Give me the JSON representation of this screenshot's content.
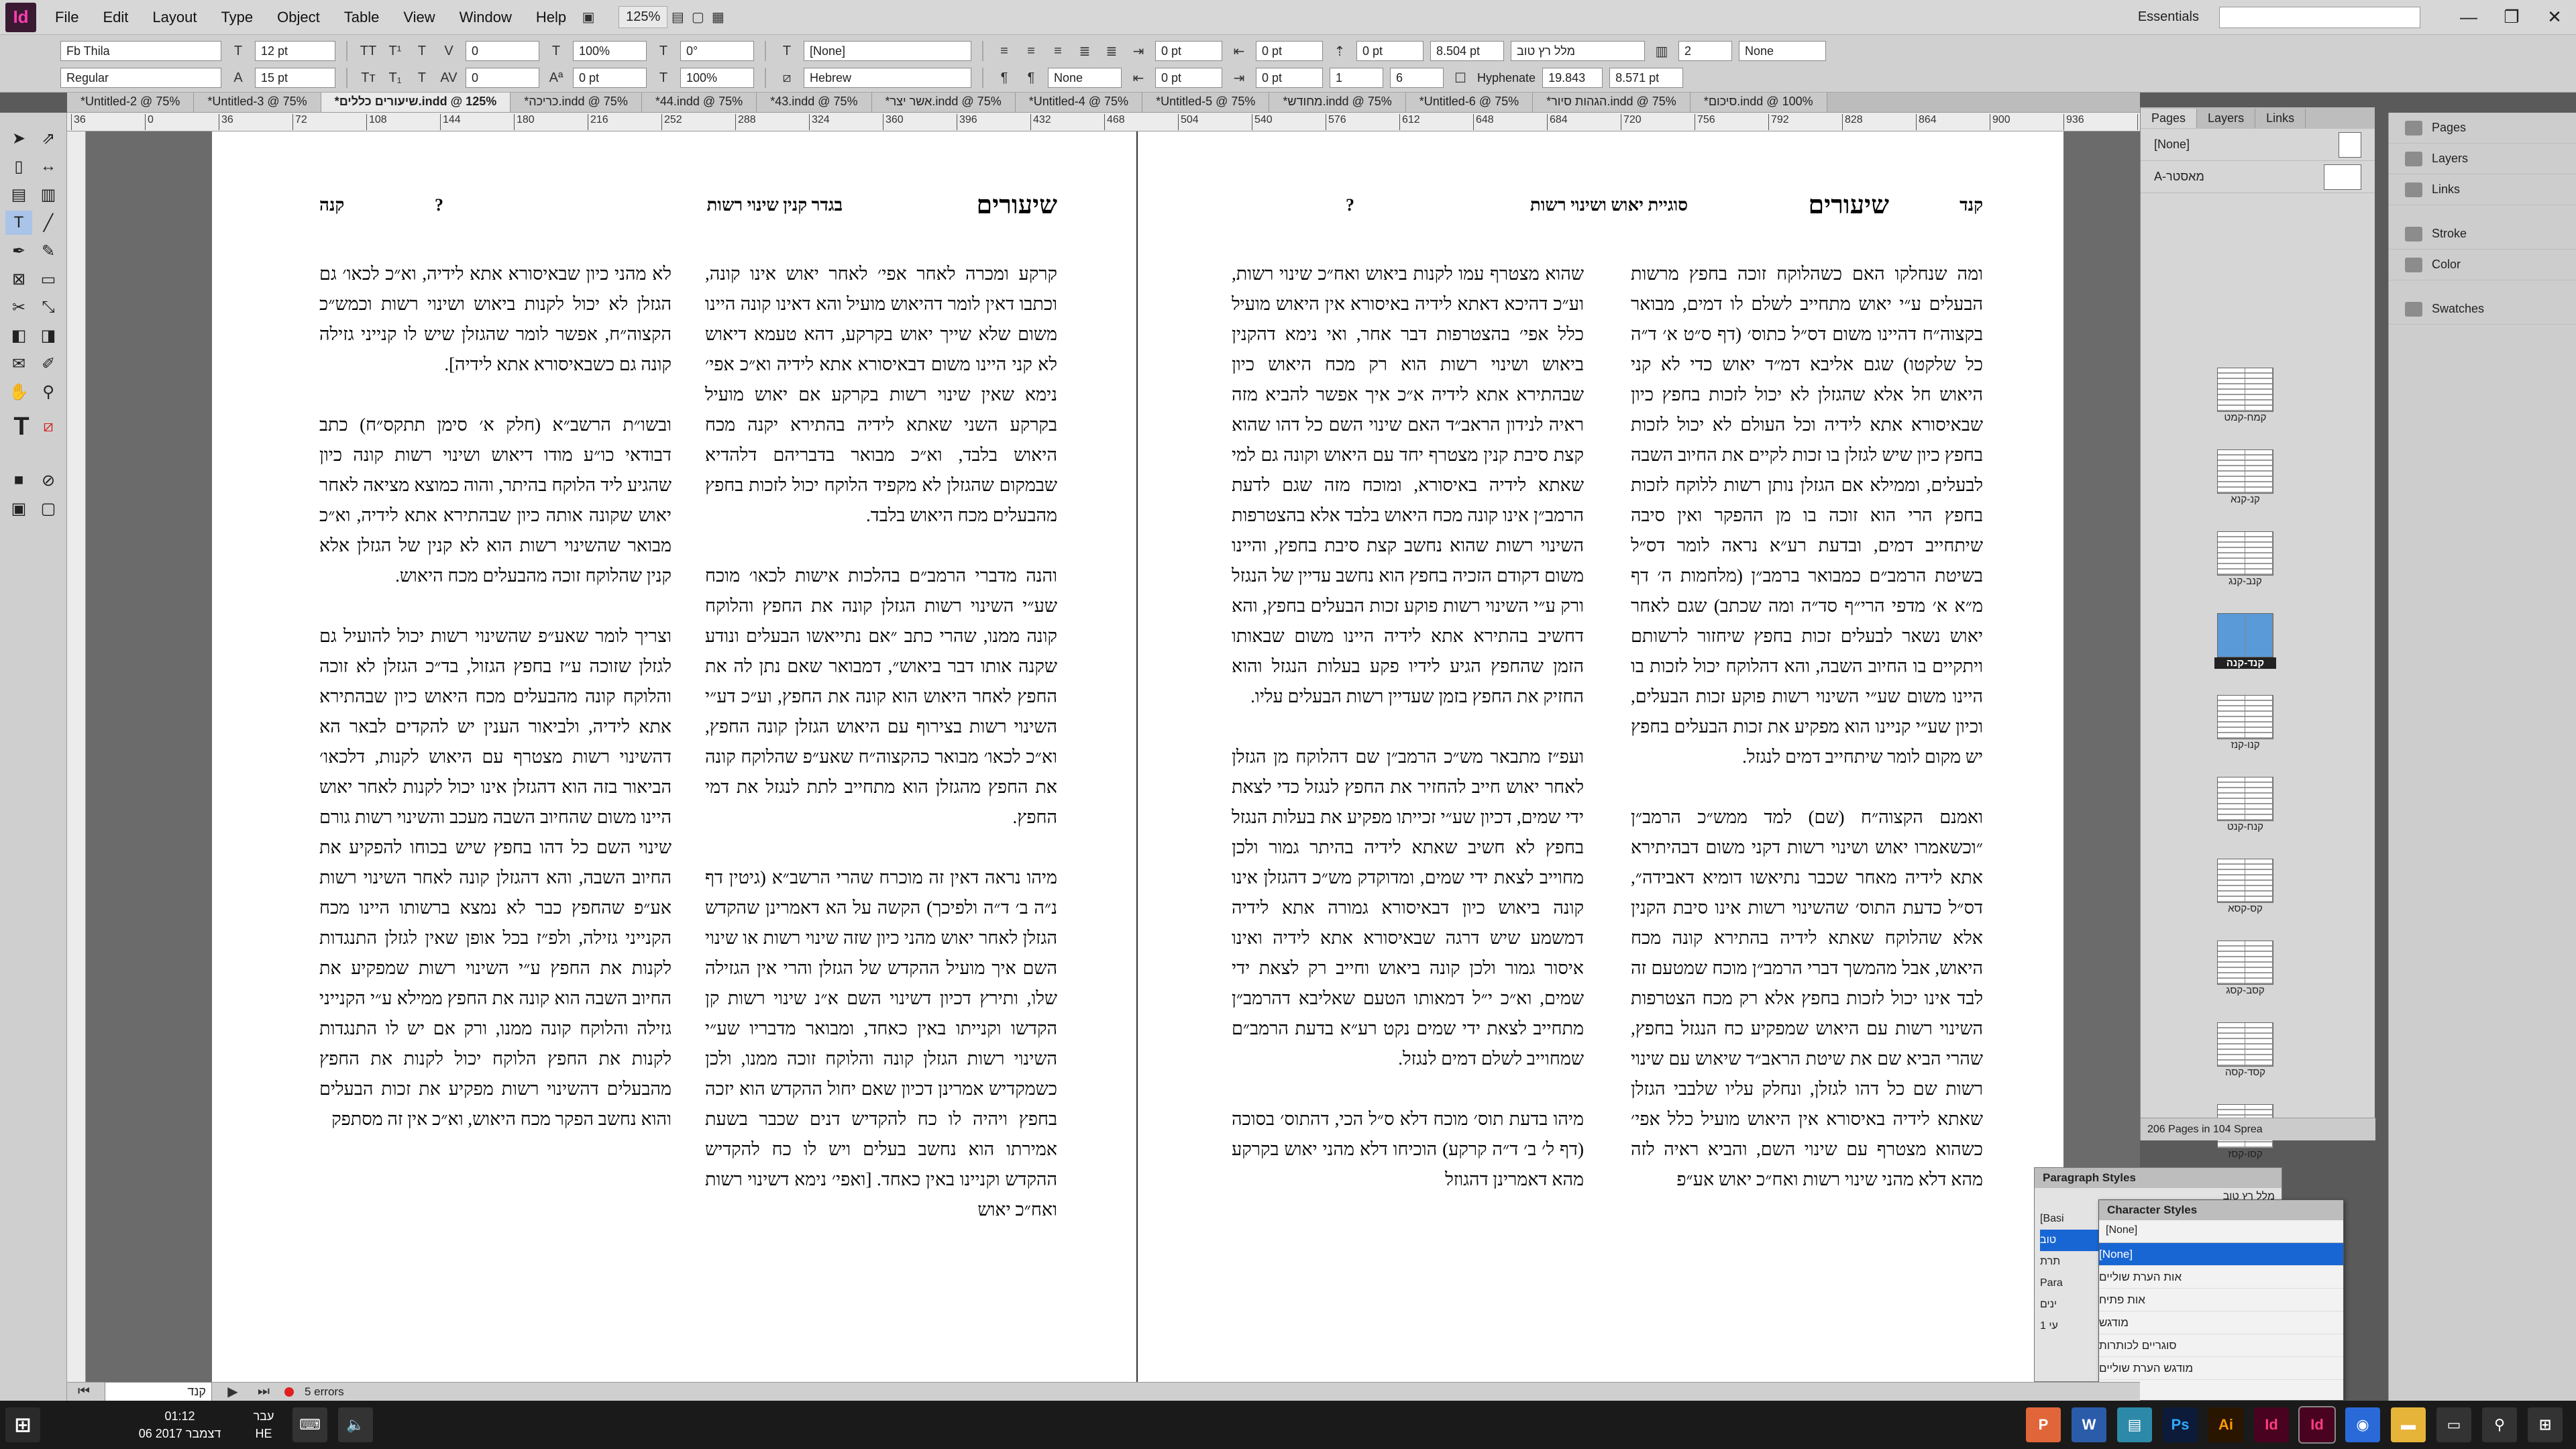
{
  "app": {
    "logo": "Id",
    "zoom": "125%",
    "workspace": "Essentials"
  },
  "menu": [
    "File",
    "Edit",
    "Layout",
    "Type",
    "Object",
    "Table",
    "View",
    "Window",
    "Help"
  ],
  "control": {
    "font": "Fb Thila",
    "style": "Regular",
    "size": "12 pt",
    "leading": "15 pt",
    "scale_v": "100%",
    "scale_h": "100%",
    "tracking": "0",
    "baseline": "0 pt",
    "skew": "0°",
    "char_style": "[None]",
    "language": "Hebrew",
    "indent1": "0 pt",
    "indent2": "0 pt",
    "indent3": "0 pt",
    "space1": "0 pt",
    "space_after": "8.504 pt",
    "para_style": "מלל רץ טוב",
    "cols": "2",
    "dropcap": "None",
    "hyphenate": "Hyphenate",
    "col_w": "19.843",
    "gutter": "8.571 pt",
    "val_none": "None",
    "n1": "1",
    "n6": "6"
  },
  "tabs": [
    "*Untitled-2 @ 75%",
    "*Untitled-3 @ 75%",
    "*שיעורים כללים.indd @ 125%",
    "*כריכה.indd @ 75%",
    "*44.indd @ 75%",
    "*43.indd @ 75%",
    "*אשר יצר.indd @ 75%",
    "*Untitled-4 @ 75%",
    "*Untitled-5 @ 75%",
    "*מחודש.indd @ 75%",
    "*Untitled-6 @ 75%",
    "*הגהות סיור.indd @ 75%",
    "*סיכום.indd @ 100%"
  ],
  "ruler_marks": [
    "36",
    "0",
    "36",
    "72",
    "108",
    "144",
    "180",
    "216",
    "252",
    "288",
    "324",
    "360",
    "396",
    "432",
    "468",
    "504",
    "540",
    "576",
    "612",
    "648",
    "684",
    "720",
    "756",
    "792",
    "828",
    "864",
    "900",
    "936",
    "972"
  ],
  "left_page": {
    "hdr_right": "שיעורים",
    "hdr_center": "בגדר קנין שינוי רשות",
    "hdr_q": "?",
    "hdr_left": "קנה",
    "col_right": "קרקע ומכרה לאחר אפי׳ לאחר יאוש אינו קונה, וכתבו דאין לומר דהיאוש מועיל והא דאינו קונה היינו משום שלא שייך יאוש בקרקע, דהא טעמא דיאוש לא קני היינו משום דבאיסורא אתא לידיה וא״כ אפי׳ נימא שאין שינוי רשות בקרקע אם יאוש מועיל בקרקע השני שאתא לידיה בהתירא יקנה מכח היאוש בלבד, וא״כ מבואר בדבריהם דלהדיא שבמקום שהגזלן לא מקפיד הלוקח יכול לזכות בחפץ מהבעלים מכח היאוש בלבד.\n\nוהנה מדברי הרמב״ם בהלכות אישות לכאו׳ מוכח שע״י השינוי רשות הגזלן קונה את החפץ והלוקח קונה ממנו, שהרי כתב ״אם נתייאשו הבעלים ונודע שקנה אותו דבר ביאוש״, דמבואר שאם נתן לה את החפץ לאחר היאוש הוא קונה את החפץ, וע״כ דע״י השינוי רשות בצירוף עם היאוש הגזלן קונה החפץ, וא״כ לכאו׳ מבואר כהקצוה״ח שאע״פ שהלוקח קונה את החפץ מהגזלן הוא מתחייב לתת לנגזל את דמי החפץ.\n\nמיהו נראה דאין זה מוכרח שהרי הרשב״א (גיטין דף נ״ה ב׳ ד״ה ולפיכך) הקשה על הא דאמרינן שהקדש הגזלן לאחר יאוש מהני כיון שזה שינוי רשות או שינוי השם איך מועיל ההקדש של הגזלן והרי אין הגזילה שלו, ותירץ דכיון דשינוי השם א״נ שינוי רשות קן הקדשו וקנייתו באין כאחד, ומבואר מדבריו שע״י השינוי רשות הגזלן קונה והלוקח זוכה ממנו, ולכן כשמקדיש אמרינן דכיון שאם יחול ההקדש הוא יזכה בחפץ ויהיה לו כח להקדיש דנים שכבר בשעת אמירתו הוא נחשב בעלים ויש לו כח להקדיש ההקדש וקניינו באין כאחד. [ואפי׳ נימא דשינוי רשות ואח״כ יאוש",
    "col_left": "לא מהני כיון שבאיסורא אתא לידיה, וא״כ לכאו׳ גם הגזלן לא יכול לקנות ביאוש ושינוי רשות וכמש״כ הקצוה״ח, אפשר לומר שהגזלן שיש לו קנייני גזילה קונה גם כשבאיסורא אתא לידיה].\n\nובשו״ת הרשב״א (חלק א׳ סימן תתקס״ח) כתב דבודאי כו״ע מודו דיאוש ושינוי רשות קונה כיון שהגיע ליד הלוקח בהיתר, והוה כמוצא מציאה לאחר יאוש שקונה אותה כיון שבהתירא אתא לידיה, וא״כ מבואר שהשינוי רשות הוא לא קנין של הגזלן אלא קנין שהלוקח זוכה מהבעלים מכח היאוש.\n\nוצריך לומר שאע״פ שהשינוי רשות יכול להועיל גם לגזלן שזוכה ע״ז בחפץ הגזול, בד״כ הגזלן לא זוכה והלוקח קונה מהבעלים מכח היאוש כיון שבהתירא אתא לידיה, ולביאור הענין יש להקדים לבאר הא דהשינוי רשות מצטרף עם היאוש לקנות, דלכאו׳ הביאור בזה הוא דהגזלן אינו יכול לקנות לאחר יאוש היינו משום שהחיוב השבה מעכב והשינוי רשות גורם שינוי השם כל דהו בחפץ שיש בכוחו להפקיע את החיוב השבה, והא דהגזלן קונה לאחר השינוי רשות אע״פ שהחפץ כבר לא נמצא ברשותו היינו מכח הקנייני גזילה, ולפ״ז בכל אופן שאין לגזלן התנגדות לקנות את החפץ ע״י השינוי רשות שמפקיע את החיוב השבה הוא קונה את החפץ ממילא ע״י הקנייני גזילה והלוקח קונה ממנו, ורק אם יש לו התנגדות לקנות את החפץ הלוקח יכול לקנות את החפץ מהבעלים דהשינוי רשות מפקיע את זכות הבעלים והוא נחשב הפקר מכח היאוש, וא״כ אין זה מסתפק"
  },
  "right_page": {
    "hdr_right": "קנד",
    "hdr_big": "שיעורים",
    "hdr_center": "סוגיית יאוש ושינוי רשות",
    "hdr_q": "?",
    "col_right": "ומה שנחלקו האם כשהלוקח זוכה בחפץ מרשות הבעלים ע״י יאוש מתחייב לשלם לו דמים, מבואר בקצוה״ח דהיינו משום דס״ל כתוס׳ (דף ס״ט א׳ ד״ה כל שלקטו) שגם אליבא דמ״ד יאוש כדי לא קני היאוש חל אלא שהגזלן לא יכול לזכות בחפץ כיון שבאיסורא אתא לידיה וכל העולם לא יכול לזכות בחפץ כיון שיש לגזלן בו זכות לקיים את החיוב השבה לבעלים, וממילא אם הגזלן נותן רשות ללוקח לזכות בחפץ הרי הוא זוכה בו מן ההפקר ואין סיבה שיתחייב דמים, ובדעת רע״א נראה לומר דס״ל בשיטת הרמב״ם כמבואר ברמב״ן (מלחמות ה׳ דף מ״א א׳ מדפי הרי״ף סד״ה ומה שכתב) שגם לאחר יאוש נשאר לבעלים זכות בחפץ שיחזור לרשותם ויתקיים בו החיוב השבה, והא דהלוקח יכול לזכות בו היינו משום שע״י השינוי רשות פוקע זכות הבעלים, וכיון שע״י קניינו הוא מפקיע את זכות הבעלים בחפץ יש מקום לומר שיתחייב דמים לנגזל.\n\nואמנם הקצוה״ח (שם) למד ממש״כ הרמב״ן ״וכשאמרו יאוש ושינוי רשות דקני משום דבהיתירא אתא לידיה מאחר שכבר נתיאשו דומיא דאבידה״, דס״ל כדעת התוס׳ שהשינוי רשות אינו סיבת הקנין אלא שהלוקח שאתא לידיה בהתירא קונה מכח היאוש, אבל מהמשך דברי הרמב״ן מוכח שמטעם זה לבד אינו יכול לזכות בחפץ אלא רק מכח הצטרפות השינוי רשות עם היאוש שמפקיע כח הנגזל בחפץ, שהרי הביא שם את שיטת הראב״ד שיאוש עם שינוי רשות שם כל דהו לגזלן, ונחלק עליו שלבבי הגזלן שאתא לידיה באיסורא אין היאוש מועיל כלל אפי׳ כשהוא מצטרף עם שינוי השם, והביא ראיה לזה מהא דלא מהני שינוי רשות ואח״כ יאוש אע״פ",
    "col_left": "שהוא מצטרף עמו לקנות ביאוש ואח״כ שינוי רשות, וע״כ דהיכא דאתא לידיה באיסורא אין היאוש מועיל כלל אפי׳ בהצטרפות דבר אחר, ואי נימא דהקנין ביאוש ושינוי רשות הוא רק מכח היאוש כיון שבהתירא אתא לידיה א״כ איך אפשר להביא מזה ראיה לנידון הראב״ד האם שינוי השם כל דהו שהוא קצת סיבת קנין מצטרף יחד עם היאוש וקונה גם למי שאתא לידיה באיסורא, ומוכח מזה שגם לדעת הרמב״ן אינו קונה מכח היאוש בלבד אלא בהצטרפות השינוי רשות שהוא נחשב קצת סיבת בחפץ, והיינו משום דקודם הזכיה בחפץ הוא נחשב עדיין של הנגזל ורק ע״י השינוי רשות פוקע זכות הבעלים בחפץ, והא דחשיב בהתירא אתא לידיה היינו משום שבאותו הזמן שהחפץ הגיע לידיו פקע בעלות הנגזל והוא החזיק את החפץ בזמן שעדיין רשות הבעלים עליו.\n\nועפ״ז מתבאר מש״כ הרמב״ן שם דהלוקח מן הגזלן לאחר יאוש חייב להחזיר את החפץ לנגזל כדי לצאת ידי שמים, דכיון שע״י זכייתו מפקיע את בעלות הנגזל בחפץ לא חשיב שאתא לידיה בהיתר גמור ולכן מחוייב לצאת ידי שמים, ומדוקדק מש״כ דהגזלן אינו קונה ביאוש כיון דבאיסורא גמורה אתא לידיה דמשמע שיש דרגה שבאיסורא אתא לידיה ואינו איסור גמור ולכן קונה ביאוש וחייב רק לצאת ידי שמים, וא״כ י״ל דמאותו הטעם שאליבא דהרמב״ן מתחייב לצאת ידי שמים נקט רע״א בדעת הרמב״ם שמחוייב לשלם דמים לנגזל.\n\nמיהו בדעת תוס׳ מוכח דלא ס״ל הכי, דהתוס׳ בסוכה (דף ל׳ ב׳ ד״ה קרקע) הוכיחו דלא מהני יאוש בקרקע מהא דאמרינן דהגוזל"
  },
  "pages_panel": {
    "tabs": [
      "Pages",
      "Layers",
      "Links"
    ],
    "master_none": "[None]",
    "master_a": "A-מאסטר",
    "spreads": [
      "קמח-קמט",
      "קנ-קנא",
      "קנב-קנג",
      "קנד-קנה",
      "קנו-קנז",
      "קנח-קנט",
      "קס-קסא",
      "קסב-קסג",
      "קסד-קסה",
      "קסו-קסז"
    ],
    "selected_index": 3,
    "footer": "206 Pages in 104 Sprea"
  },
  "side_panel": [
    "Pages",
    "Layers",
    "Links",
    "Stroke",
    "Color",
    "Swatches"
  ],
  "paragraph_styles": {
    "title": "Paragraph Styles",
    "current": "מלל רץ טוב",
    "items": [
      "[Basi",
      "טוב",
      "תרת",
      "Para",
      "ינים",
      "עי 1"
    ]
  },
  "character_styles": {
    "title": "Character Styles",
    "current": "[None]",
    "items": [
      "[None]",
      "אות הערת שוליים",
      "אות פתיח",
      "מודגש",
      "סוגריים לכותרות",
      "מודגש הערת שוליים"
    ]
  },
  "status": {
    "page": "קנד",
    "errors": "5 errors"
  },
  "taskbar": {
    "time": "01:12",
    "date": "06 דצמבר 2017",
    "lang1": "עבר",
    "lang2": "HE"
  }
}
